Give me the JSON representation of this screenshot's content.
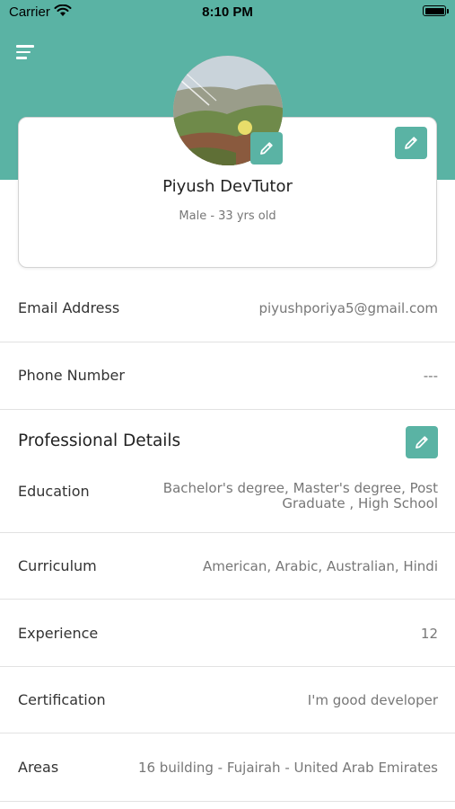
{
  "status_bar": {
    "carrier": "Carrier",
    "time": "8:10 PM"
  },
  "theme": {
    "accent": "#5ab3a4"
  },
  "profile": {
    "name": "Piyush DevTutor",
    "subtitle": "Male - 33 yrs old"
  },
  "contact": {
    "email_label": "Email Address",
    "email_value": "piyushporiya5@gmail.com",
    "phone_label": "Phone Number",
    "phone_value": "---"
  },
  "professional": {
    "title": "Professional Details",
    "education_label": "Education",
    "education_value_line1": "Bachelor's degree, Master's degree, Post",
    "education_value_line2": "Graduate , High School",
    "curriculum_label": "Curriculum",
    "curriculum_value": "American, Arabic, Australian, Hindi",
    "experience_label": "Experience",
    "experience_value": "12",
    "certification_label": "Certification",
    "certification_value": "I'm good developer",
    "areas_label": "Areas",
    "areas_value": "16 building - Fujairah - United Arab Emirates"
  }
}
